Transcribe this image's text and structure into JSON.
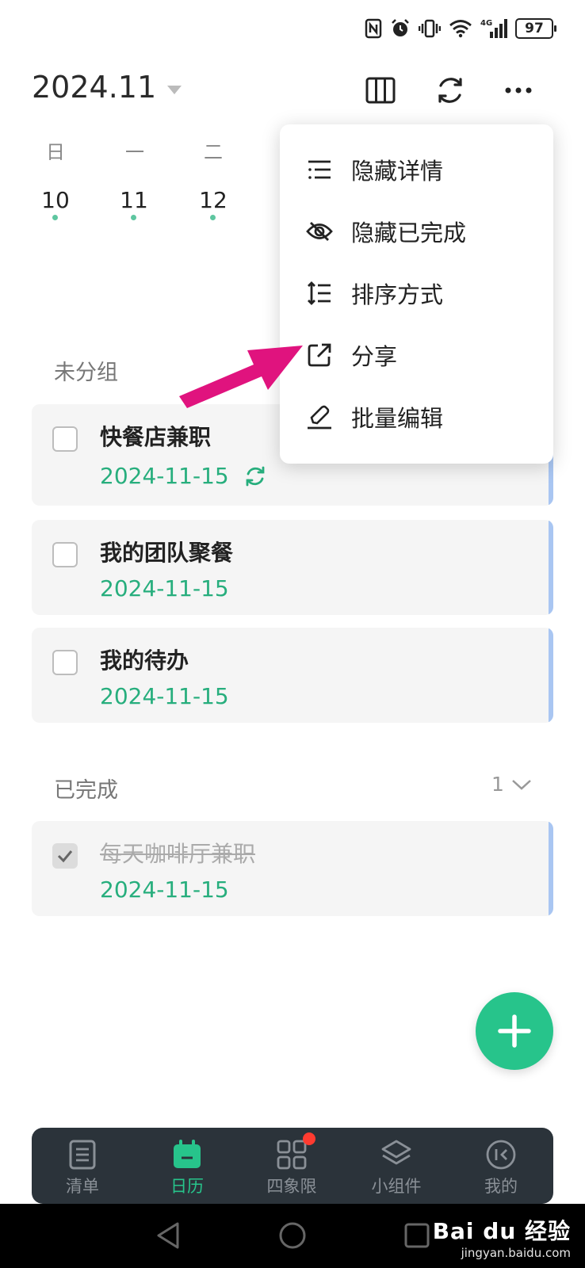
{
  "status_bar": {
    "battery": "97",
    "network": "4G"
  },
  "header": {
    "month": "2024.11"
  },
  "week": {
    "weekdays": [
      "日",
      "一",
      "二"
    ],
    "days": [
      "10",
      "11",
      "12"
    ]
  },
  "groups": {
    "ungrouped_label": "未分组",
    "completed_label": "已完成",
    "completed_count": "1"
  },
  "tasks": [
    {
      "title": "快餐店兼职",
      "date": "2024-11-15",
      "repeat": true,
      "done": false
    },
    {
      "title": "我的团队聚餐",
      "date": "2024-11-15",
      "repeat": false,
      "done": false
    },
    {
      "title": "我的待办",
      "date": "2024-11-15",
      "repeat": false,
      "done": false
    }
  ],
  "completed_tasks": [
    {
      "title": "每天咖啡厅兼职",
      "date": "2024-11-15",
      "done": true
    }
  ],
  "menu": {
    "items": [
      {
        "label": "隐藏详情",
        "icon": "list-icon"
      },
      {
        "label": "隐藏已完成",
        "icon": "eye-off-icon"
      },
      {
        "label": "排序方式",
        "icon": "sort-icon"
      },
      {
        "label": "分享",
        "icon": "share-icon"
      },
      {
        "label": "批量编辑",
        "icon": "edit-icon"
      }
    ]
  },
  "nav": {
    "items": [
      {
        "label": "清单",
        "icon": "list-doc-icon"
      },
      {
        "label": "日历",
        "icon": "calendar-icon"
      },
      {
        "label": "四象限",
        "icon": "grid-icon"
      },
      {
        "label": "小组件",
        "icon": "layers-icon"
      },
      {
        "label": "我的",
        "icon": "profile-icon"
      }
    ],
    "active_index": 1
  },
  "watermark": {
    "main": "Bai du 经验",
    "sub": "jingyan.baidu.com"
  },
  "colors": {
    "accent": "#27c48b",
    "date": "#27ae7d",
    "card_bar": "#a9c6f2",
    "arrow": "#e0137e",
    "nav_bg": "#2b333a"
  }
}
